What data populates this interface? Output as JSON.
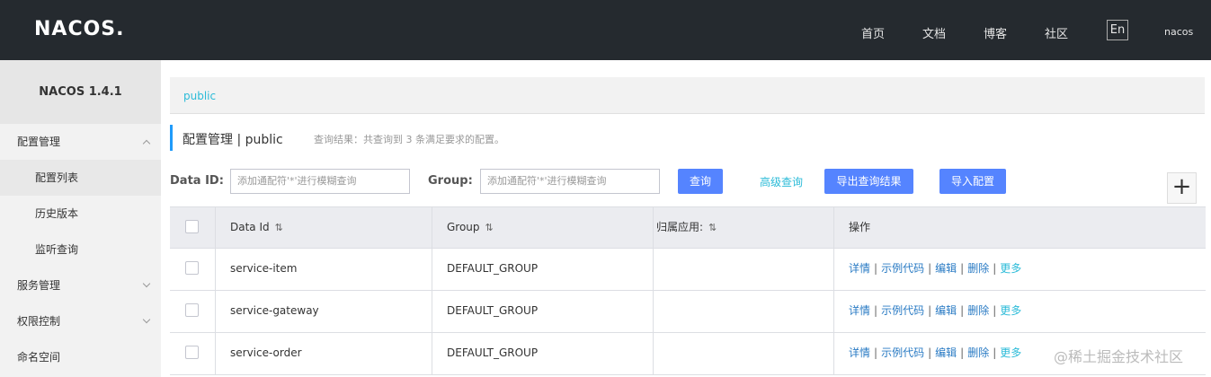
{
  "header": {
    "logo": "NACOS.",
    "nav": [
      "首页",
      "文档",
      "博客",
      "社区"
    ],
    "lang": "En",
    "user": "nacos"
  },
  "sidebar": {
    "version": "NACOS 1.4.1",
    "items": [
      {
        "label": "配置管理",
        "type": "top",
        "chevron": "up"
      },
      {
        "label": "配置列表",
        "type": "sub",
        "active": true
      },
      {
        "label": "历史版本",
        "type": "sub"
      },
      {
        "label": "监听查询",
        "type": "sub"
      },
      {
        "label": "服务管理",
        "type": "top",
        "chevron": "down"
      },
      {
        "label": "权限控制",
        "type": "top",
        "chevron": "down"
      },
      {
        "label": "命名空间",
        "type": "top"
      }
    ]
  },
  "breadcrumb": {
    "namespace": "public"
  },
  "page": {
    "title": "配置管理 | public",
    "subtitle": "查询结果：共查询到 3 条满足要求的配置。"
  },
  "search": {
    "data_id_label": "Data ID:",
    "data_id_placeholder": "添加通配符'*'进行模糊查询",
    "group_label": "Group:",
    "group_placeholder": "添加通配符'*'进行模糊查询",
    "query_button": "查询",
    "advanced_query": "高级查询",
    "export_button": "导出查询结果",
    "import_button": "导入配置"
  },
  "table": {
    "headers": [
      "Data Id",
      "Group",
      "归属应用:",
      "操作"
    ],
    "rows": [
      {
        "data_id": "service-item",
        "group": "DEFAULT_GROUP",
        "app": ""
      },
      {
        "data_id": "service-gateway",
        "group": "DEFAULT_GROUP",
        "app": ""
      },
      {
        "data_id": "service-order",
        "group": "DEFAULT_GROUP",
        "app": ""
      }
    ],
    "actions": [
      "详情",
      "示例代码",
      "编辑",
      "删除",
      "更多"
    ]
  },
  "watermark": "@稀土掘金技术社区",
  "colors": {
    "header_bg": "#252a2f",
    "primary": "#5584ff",
    "link": "#2a7bc4",
    "accent": "#2bbbd8"
  },
  "icons": {
    "plus": "plus-icon",
    "sort": "sort-icon",
    "chevron": "chevron-icon"
  }
}
